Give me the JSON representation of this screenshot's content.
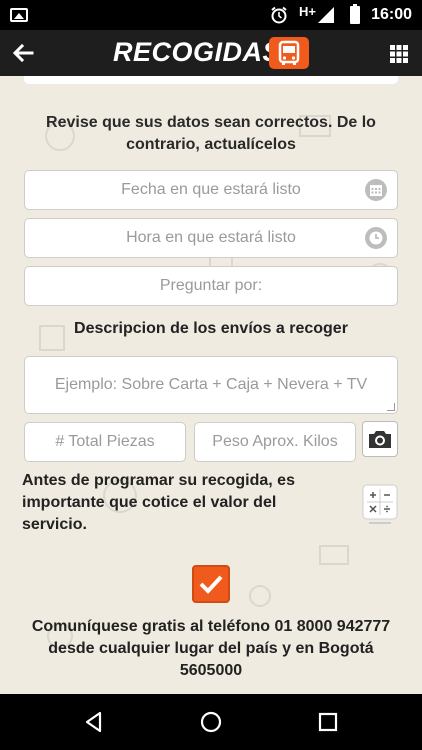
{
  "status_bar": {
    "network": "H+",
    "time": "16:00"
  },
  "app_bar": {
    "title": "RECOGIDAS",
    "brand_color": "#f05a1c"
  },
  "form": {
    "instructions": "Revise que sus datos sean correctos. De lo contrario, actualícelos",
    "fecha_placeholder": "Fecha en que estará listo",
    "hora_placeholder": "Hora en que estará listo",
    "preguntar_placeholder": "Preguntar por:",
    "description_title": "Descripcion de los envíos a recoger",
    "description_placeholder": "Ejemplo: Sobre Carta + Caja + Nevera + TV",
    "pieces_placeholder": "# Total Piezas",
    "weight_placeholder": "Peso Aprox. Kilos",
    "quote_text": "Antes de programar su recogida, es importante que cotice el valor del servicio.",
    "checkbox_checked": true,
    "contact_text": "Comuníquese gratis al teléfono 01 8000 942777 desde cualquier lugar del país y en Bogotá 5605000"
  },
  "icons": [
    "back-arrow-icon",
    "bus-icon",
    "grid-menu-icon",
    "calendar-icon",
    "clock-icon",
    "camera-icon",
    "calculator-icon",
    "check-icon"
  ]
}
